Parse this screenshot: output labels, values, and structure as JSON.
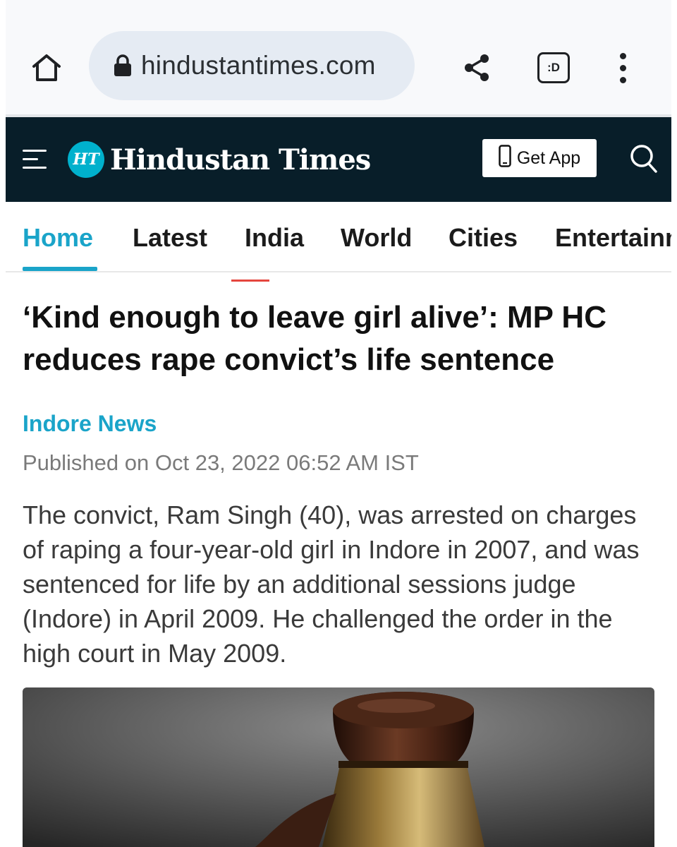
{
  "browser": {
    "url": "hindustantimes.com",
    "tab_button_label": ":D"
  },
  "site": {
    "logo_badge": "HT",
    "logo_name": "Hindustan Times",
    "get_app_label": "Get App"
  },
  "nav": {
    "items": [
      {
        "label": "Home",
        "active": true
      },
      {
        "label": "Latest"
      },
      {
        "label": "India"
      },
      {
        "label": "World"
      },
      {
        "label": "Cities"
      },
      {
        "label": "Entertainm"
      }
    ]
  },
  "article": {
    "headline": "‘Kind enough to leave girl alive’: MP HC reduces rape convict’s life sentence",
    "section": "Indore News",
    "published": "Published on Oct 23, 2022 06:52 AM IST",
    "summary": "The convict, Ram Singh (40), was arrested on charges of raping a four-year-old girl in Indore in 2007, and was sentenced for life by an additional sessions judge (Indore) in April 2009. He challenged the order in the high court in May 2009."
  },
  "colors": {
    "header_bg": "#081e29",
    "accent": "#1aa4c9",
    "brand_badge": "#00b1cd",
    "url_pill": "#e5ebf3"
  },
  "icons": {
    "home": "home-icon",
    "lock": "lock-icon",
    "share": "share-icon",
    "menu": "more-vert-icon",
    "hamburger": "hamburger-icon",
    "phone": "phone-icon",
    "search": "search-icon"
  }
}
